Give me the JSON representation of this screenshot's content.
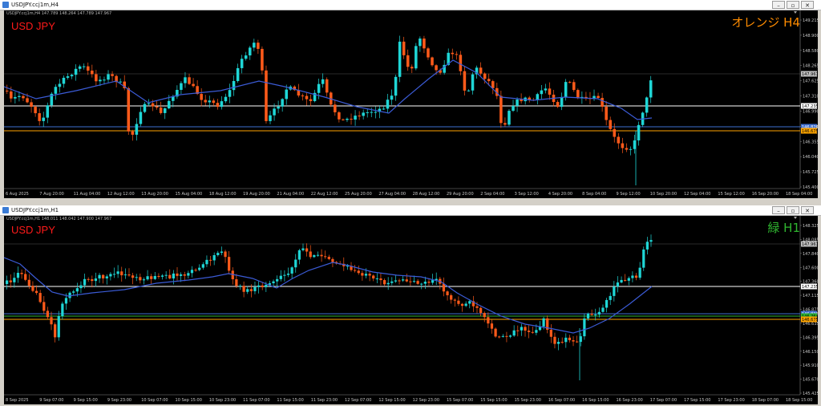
{
  "windows": [
    {
      "title": "USDJPY.ccj1m,H4",
      "info": "USDJPY.ccj1m,H4  147.789 148.264 147.789 147.967",
      "symbol": "USD JPY",
      "timeframe_label": "オレンジ H4",
      "timeframe_color": "#ff8c00",
      "yticks": [
        "149.215",
        "148.900",
        "148.580",
        "148.265",
        "147.625",
        "147.310",
        "146.990",
        "146.670",
        "146.355",
        "146.040",
        "145.725",
        "145.400"
      ],
      "xticks": [
        "6 Aug 2025",
        "7 Aug 20:00",
        "11 Aug 04:00",
        "12 Aug 12:00",
        "13 Aug 20:00",
        "15 Aug 04:00",
        "18 Aug 12:00",
        "19 Aug 20:00",
        "21 Aug 04:00",
        "22 Aug 12:00",
        "25 Aug 20:00",
        "27 Aug 04:00",
        "28 Aug 12:00",
        "29 Aug 20:00",
        "2 Sep 04:00",
        "3 Sep 12:00",
        "4 Sep 20:00",
        "8 Sep 04:00",
        "9 Sep 12:00",
        "10 Sep 20:00",
        "12 Sep 04:00",
        "15 Sep 12:00",
        "16 Sep 20:00",
        "18 Sep 04:00"
      ],
      "price_tags": [
        {
          "text": "147.967",
          "bg": "#c0c0c0",
          "fg": "#000000"
        },
        {
          "text": "147.235",
          "bg": "#ffffff",
          "fg": "#000000"
        },
        {
          "text": "146.826",
          "bg": "#3e6fd1",
          "fg": "#ffffff"
        },
        {
          "text": "146.675",
          "bg": "#ffa500",
          "fg": "#000000"
        }
      ]
    },
    {
      "title": "USDJPY.ccj1m,H1",
      "info": "USDJPY.ccj1m,H1  148.011 148.042 147.900 147.967",
      "symbol": "USD JPY",
      "timeframe_label": "緑 H1",
      "timeframe_color": "#2fb52f",
      "yticks": [
        "148.325",
        "148.085",
        "147.840",
        "147.600",
        "147.360",
        "147.115",
        "146.875",
        "146.635",
        "146.395",
        "146.150",
        "145.910",
        "145.670",
        "145.425"
      ],
      "xticks": [
        "8 Sep 2025",
        "9 Sep 07:00",
        "9 Sep 15:00",
        "9 Sep 23:00",
        "10 Sep 07:00",
        "10 Sep 15:00",
        "10 Sep 23:00",
        "11 Sep 07:00",
        "11 Sep 15:00",
        "11 Sep 23:00",
        "12 Sep 07:00",
        "12 Sep 15:00",
        "12 Sep 23:00",
        "15 Sep 07:00",
        "15 Sep 15:00",
        "15 Sep 23:00",
        "16 Sep 07:00",
        "16 Sep 15:00",
        "16 Sep 23:00",
        "17 Sep 07:00",
        "17 Sep 15:00",
        "17 Sep 23:00",
        "18 Sep 07:00",
        "18 Sep 15:00"
      ],
      "price_tags": [
        {
          "text": "147.967",
          "bg": "#c0c0c0",
          "fg": "#000000"
        },
        {
          "text": "147.235",
          "bg": "#ffffff",
          "fg": "#000000"
        },
        {
          "text": "146.826",
          "bg": "#3e6fd1",
          "fg": "#ffffff"
        },
        {
          "text": "146.764",
          "bg": "#2fb52f",
          "fg": "#000000"
        },
        {
          "text": "146.675",
          "bg": "#ffa500",
          "fg": "#000000"
        }
      ]
    }
  ],
  "colors": {
    "bull": "#1fd6d6",
    "bear": "#ff5a1a",
    "ma": "#3b5bd6",
    "bg": "#000000"
  }
}
